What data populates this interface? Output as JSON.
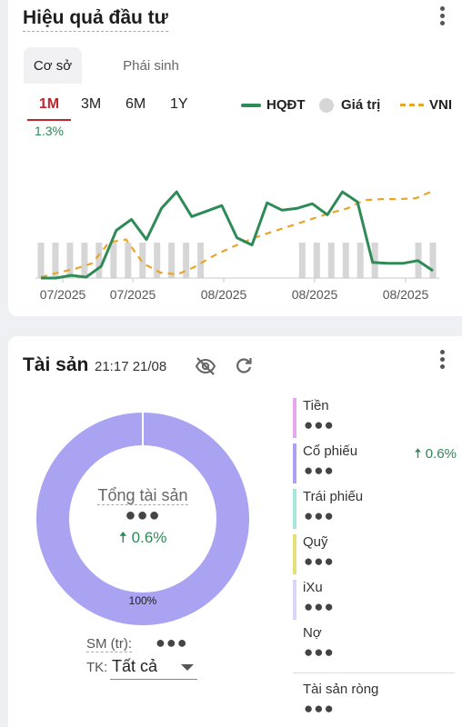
{
  "performance": {
    "title": "Hiệu quả đầu tư",
    "tabs": [
      "Cơ sở",
      "Phái sinh"
    ],
    "periods": [
      "1M",
      "3M",
      "6M",
      "1Y"
    ],
    "selected_period_change": "1.3%",
    "legend": {
      "hqdt": "HQĐT",
      "gia_tri": "Giá trị",
      "vni": "VNI"
    },
    "colors": {
      "hqdt": "#2e8b57",
      "gia_tri": "#d6d6d6",
      "vni": "#e8a52b",
      "selected": "#c0262d"
    }
  },
  "chart_data": {
    "type": "line",
    "x_tick_labels": [
      "07/2025",
      "07/2025",
      "08/2025",
      "08/2025",
      "08/2025"
    ],
    "series": [
      {
        "name": "HQĐT",
        "values": [
          0.0,
          0.0,
          0.3,
          0.1,
          1.3,
          5.2,
          6.4,
          4.2,
          7.6,
          9.4,
          6.7,
          7.3,
          7.9,
          4.4,
          3.6,
          8.2,
          7.4,
          7.6,
          8.1,
          6.9,
          9.4,
          8.3,
          1.7,
          1.6,
          1.6,
          1.9,
          0.8
        ]
      },
      {
        "name": "VNI",
        "values": [
          0.1,
          0.6,
          1.0,
          1.6,
          3.9,
          4.2,
          1.6,
          0.6,
          0.4,
          1.2,
          2.3,
          3.2,
          4.0,
          4.7,
          5.3,
          5.9,
          6.5,
          7.1,
          7.6,
          8.5,
          8.6,
          8.6,
          8.7,
          9.5
        ]
      },
      {
        "name": "Giá trị",
        "values": [
          1,
          1,
          1,
          1,
          1,
          1,
          1,
          1,
          1,
          1,
          1,
          1,
          1,
          1,
          1,
          1,
          1,
          1,
          1,
          1,
          1,
          1,
          1,
          1,
          1,
          1,
          1,
          1
        ]
      }
    ],
    "grid": false,
    "legend_position": "top-right"
  },
  "assets": {
    "title": "Tài sản",
    "time": "21:17 21/08",
    "total_label": "Tổng tài sản",
    "total_value": "●●●",
    "total_change": "0.6%",
    "donut_percent": "100%",
    "donut_color": "#a9a3f2",
    "sm_label": "SM (tr):",
    "sm_value": "●●●",
    "tk_label": "TK:",
    "tk_value": "Tất cả",
    "items": [
      {
        "name": "Tiền",
        "value": "●●●",
        "change": "",
        "color": "#e6a8ea"
      },
      {
        "name": "Cổ phiếu",
        "value": "●●●",
        "change": "0.6%",
        "color": "#a9a3f2"
      },
      {
        "name": "Trái phiếu",
        "value": "●●●",
        "change": "",
        "color": "#a8e6dc"
      },
      {
        "name": "Quỹ",
        "value": "●●●",
        "change": "",
        "color": "#e3e07a"
      },
      {
        "name": "iXu",
        "value": "●●●",
        "change": "",
        "color": "#d9d6f5"
      },
      {
        "name": "Nợ",
        "value": "●●●",
        "change": "",
        "color": ""
      }
    ],
    "net": {
      "name": "Tài sản ròng",
      "value": "●●●"
    }
  }
}
